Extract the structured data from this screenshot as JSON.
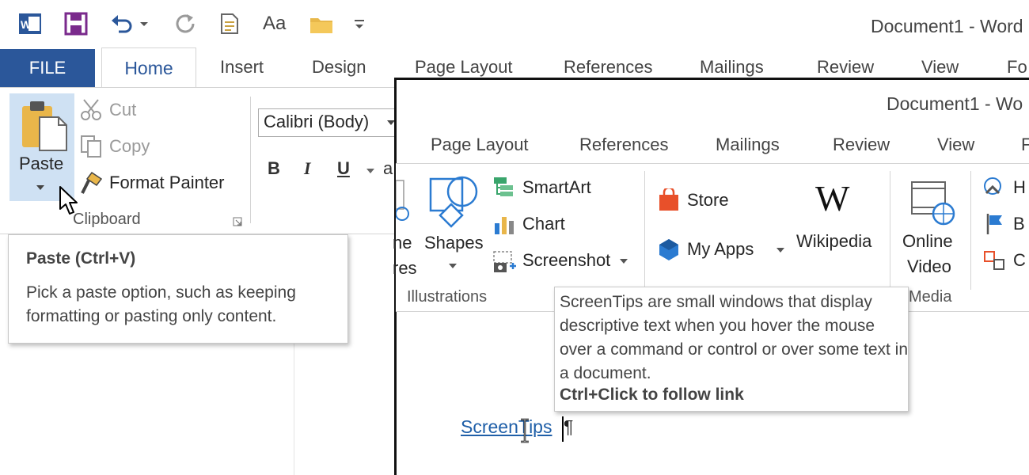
{
  "background_window": {
    "title": "Document1 - Word",
    "file_tab": "FILE",
    "tabs": [
      "Home",
      "Insert",
      "Design",
      "Page Layout",
      "References",
      "Mailings",
      "Review",
      "View",
      "Fo"
    ],
    "clipboard": {
      "paste": "Paste",
      "cut": "Cut",
      "copy": "Copy",
      "format_painter": "Format Painter",
      "group_label": "Clipboard"
    },
    "font": {
      "name": "Calibri (Body)",
      "bold": "B",
      "italic": "I",
      "underline": "U",
      "a_letter": "a"
    },
    "qat_format_label": "Aa"
  },
  "paste_tooltip": {
    "title": "Paste (Ctrl+V)",
    "body": "Pick a paste option, such as keeping formatting or pasting only content."
  },
  "foreground_window": {
    "title": "Document1 - Wo",
    "tabs": [
      "Page Layout",
      "References",
      "Mailings",
      "Review",
      "View",
      "F"
    ],
    "illustrations": {
      "partial_pictures_line1": "ne",
      "partial_pictures_line2": "res",
      "shapes": "Shapes",
      "smartart": "SmartArt",
      "chart": "Chart",
      "screenshot": "Screenshot",
      "group_label": "Illustrations"
    },
    "apps": {
      "store": "Store",
      "my_apps": "My Apps",
      "wikipedia": "Wikipedia",
      "wikipedia_logo": "W"
    },
    "media": {
      "online_video_line1": "Online",
      "online_video_line2": "Video",
      "group_label": "Media"
    },
    "links_partial": [
      "H",
      "B",
      "C"
    ]
  },
  "screentips_tooltip": {
    "body": "ScreenTips are small windows that display descriptive text when you hover the mouse over a command or control or over some text in a document.",
    "action": "Ctrl+Click to follow link"
  },
  "document": {
    "link_text": "ScreenTips",
    "pilcrow": "¶"
  },
  "colors": {
    "word_blue": "#2b579a",
    "paste_highlight": "#cfe1f3",
    "link": "#1f5fa8"
  }
}
